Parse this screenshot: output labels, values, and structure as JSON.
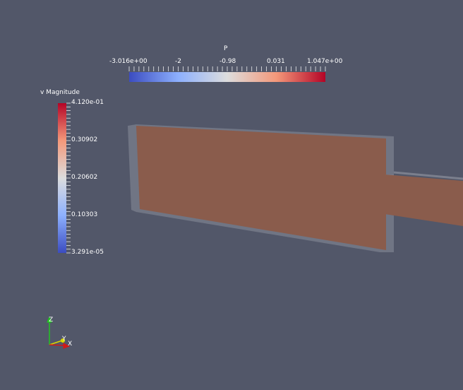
{
  "viewport": {
    "background": "#525769"
  },
  "scalar_bar_p": {
    "title": "P",
    "tick_labels": [
      "-3.016e+00",
      "-2",
      "-0.98",
      "0.031",
      "1.047e+00"
    ],
    "colormap": [
      "#3b4cc0",
      "#8db0fe",
      "#dddddd",
      "#f4987a",
      "#b40426"
    ]
  },
  "scalar_bar_v": {
    "title": "v Magnitude",
    "tick_labels": [
      "4.120e-01",
      "0.30902",
      "0.20602",
      "0.10303",
      "3.291e-05"
    ],
    "colormap": [
      "#b40426",
      "#f4987a",
      "#dddddd",
      "#8db0fe",
      "#3b4cc0"
    ]
  },
  "geometry": {
    "surface_color": "#8a5c4c",
    "outline_color": "#7b7f8d"
  },
  "orientation_axes": {
    "z_label": "Z",
    "y_label": "Y",
    "x_label": "X",
    "z_color": "#22c322",
    "y_color": "#d8d800",
    "x_color": "#d01818"
  }
}
